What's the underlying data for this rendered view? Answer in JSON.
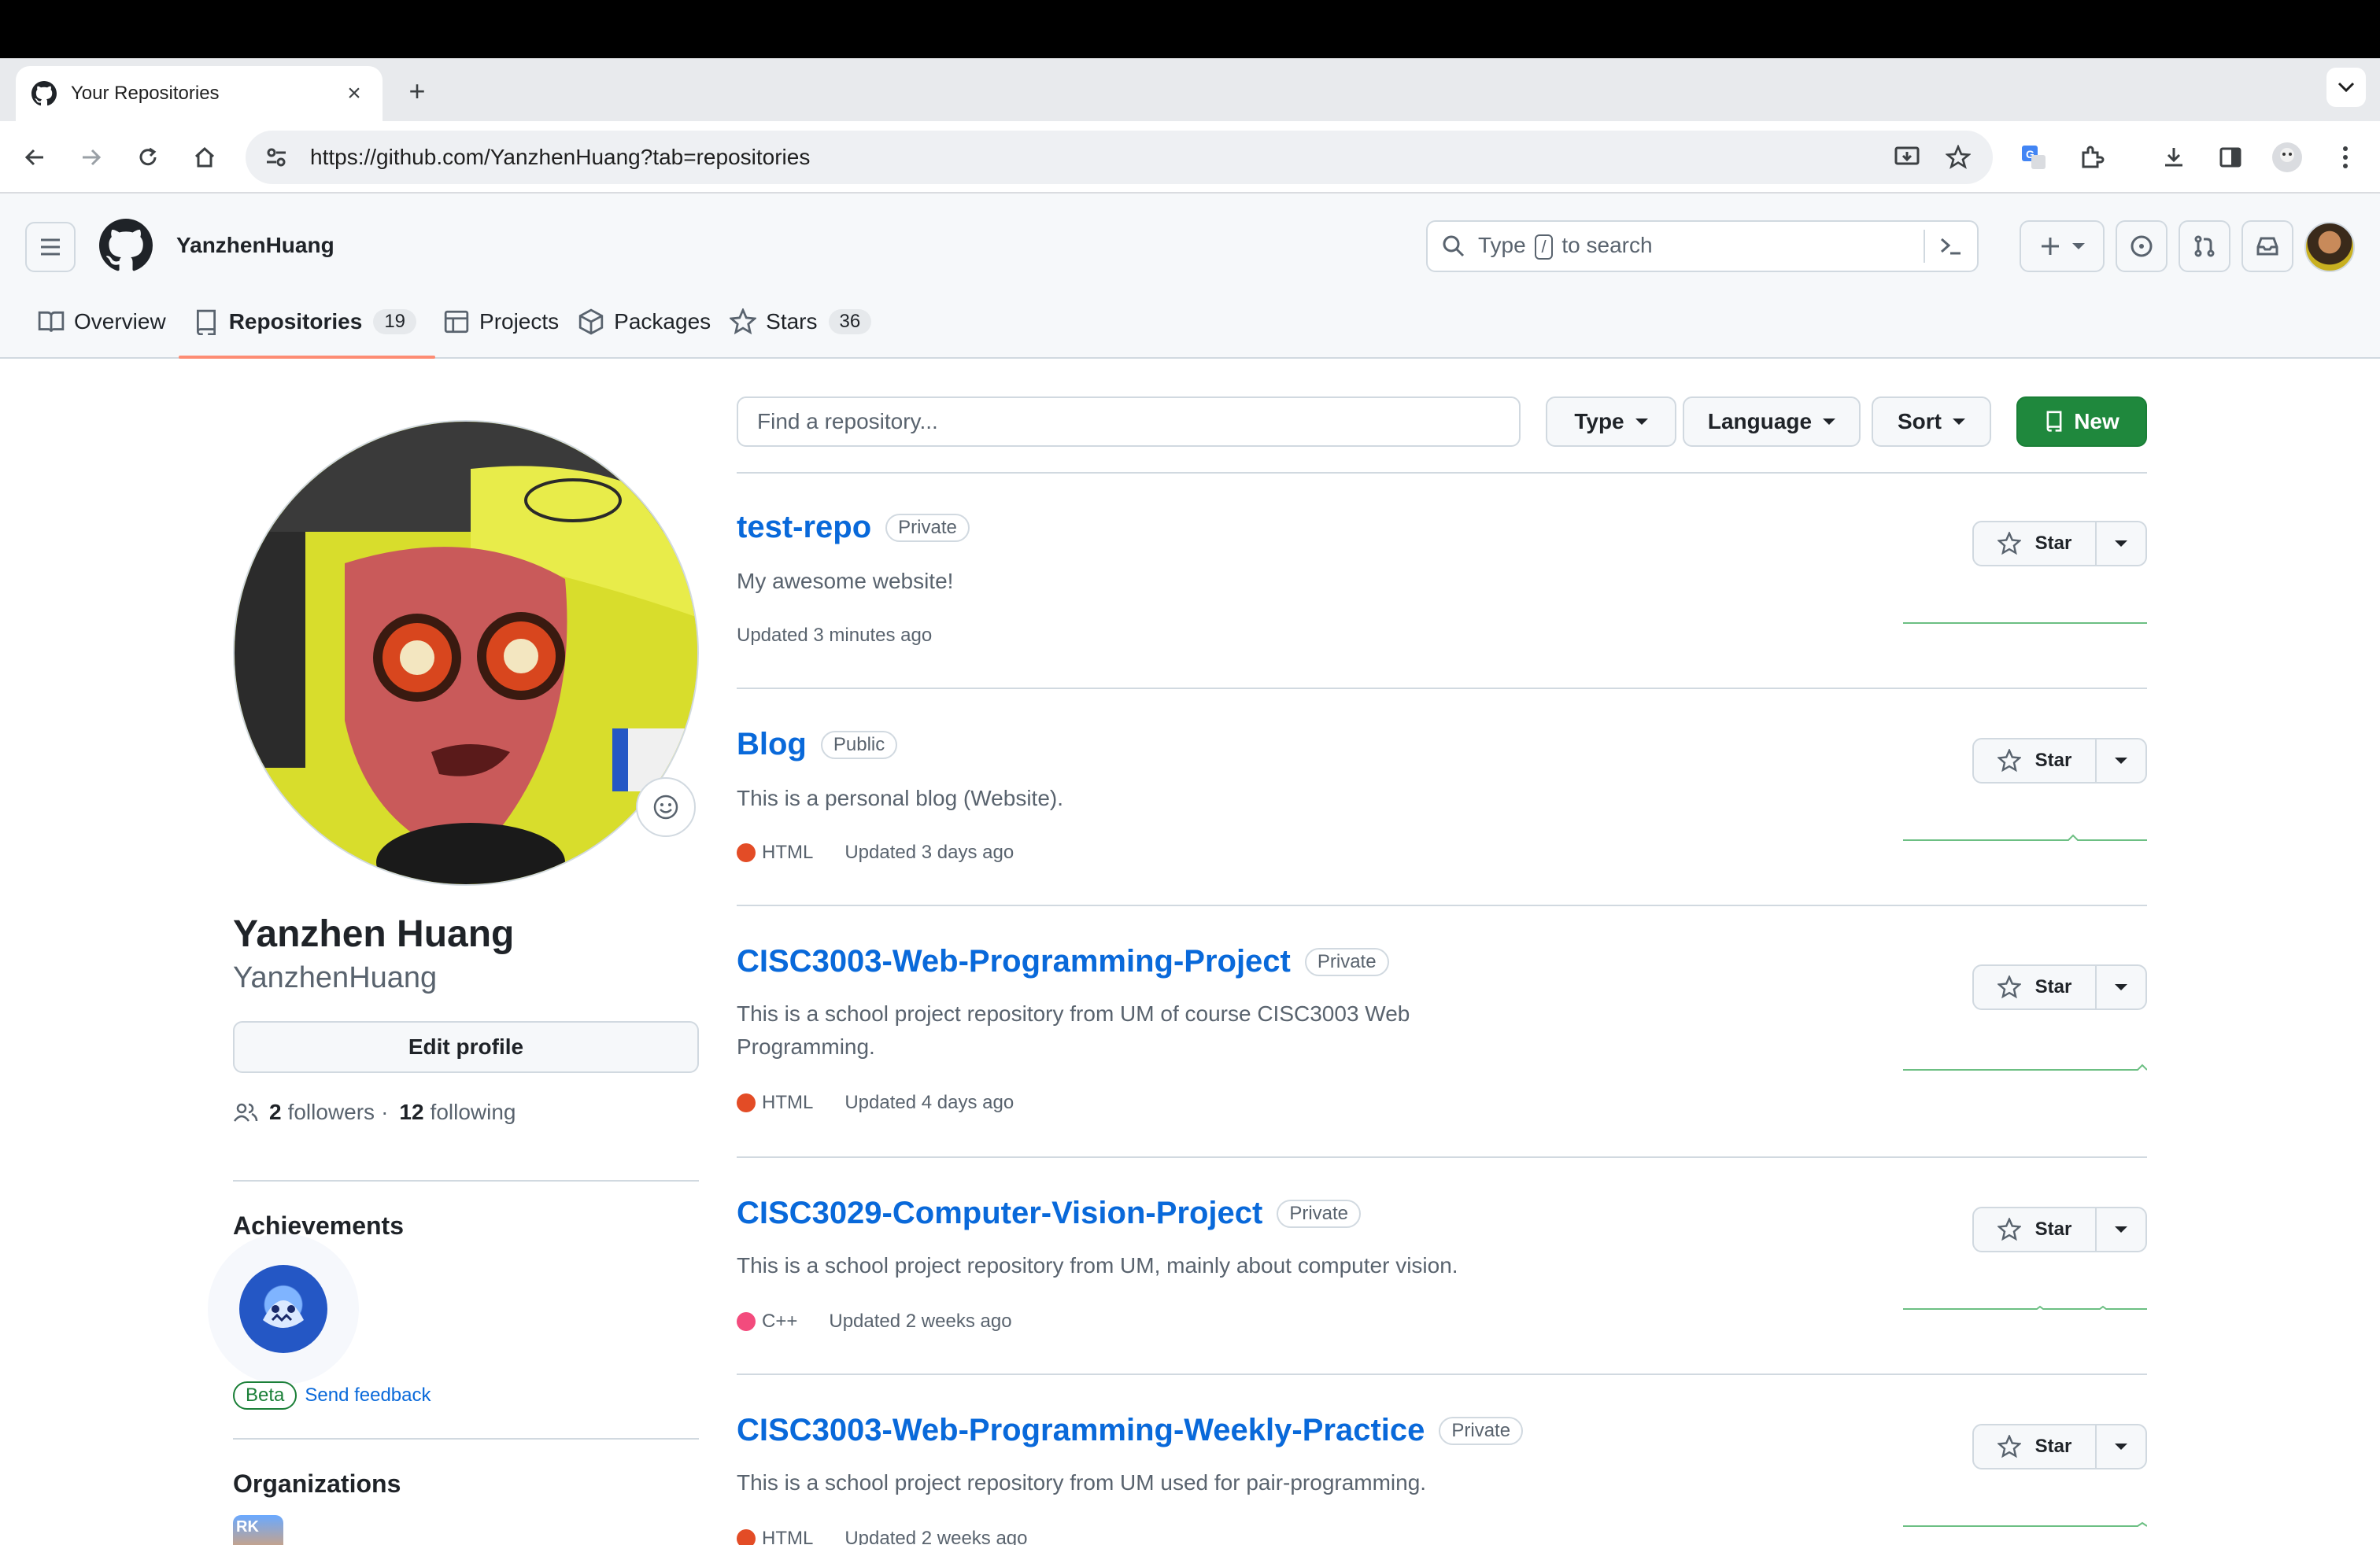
{
  "browser": {
    "tab_title": "Your Repositories",
    "url": "https://github.com/YanzhenHuang?tab=repositories"
  },
  "header": {
    "username": "YanzhenHuang",
    "search_placeholder_pre": "Type",
    "search_placeholder_key": "/",
    "search_placeholder_post": "to search"
  },
  "nav": {
    "overview": "Overview",
    "repositories": "Repositories",
    "repositories_count": "19",
    "projects": "Projects",
    "packages": "Packages",
    "stars": "Stars",
    "stars_count": "36"
  },
  "profile": {
    "full_name": "Yanzhen Huang",
    "login": "YanzhenHuang",
    "edit_label": "Edit profile",
    "followers_count": "2",
    "followers_label": "followers",
    "sep": "·",
    "following_count": "12",
    "following_label": "following",
    "achievements_title": "Achievements",
    "beta_label": "Beta",
    "feedback_label": "Send feedback",
    "organizations_title": "Organizations",
    "org_label": "RK"
  },
  "filters": {
    "find_placeholder": "Find a repository...",
    "type_label": "Type",
    "language_label": "Language",
    "sort_label": "Sort",
    "new_label": "New"
  },
  "repos": [
    {
      "name": "test-repo",
      "visibility": "Private",
      "description": "My awesome website!",
      "language": "",
      "lang_color": "",
      "updated": "Updated 3 minutes ago",
      "star_label": "Star"
    },
    {
      "name": "Blog",
      "visibility": "Public",
      "description": "This is a personal blog (Website).",
      "language": "HTML",
      "lang_color": "#e34c26",
      "updated": "Updated 3 days ago",
      "star_label": "Star"
    },
    {
      "name": "CISC3003-Web-Programming-Project",
      "visibility": "Private",
      "description": "This is a school project repository from UM of course CISC3003 Web Programming.",
      "language": "HTML",
      "lang_color": "#e34c26",
      "updated": "Updated 4 days ago",
      "star_label": "Star"
    },
    {
      "name": "CISC3029-Computer-Vision-Project",
      "visibility": "Private",
      "description": "This is a school project repository from UM, mainly about computer vision.",
      "language": "C++",
      "lang_color": "#f34b7d",
      "updated": "Updated 2 weeks ago",
      "star_label": "Star"
    },
    {
      "name": "CISC3003-Web-Programming-Weekly-Practice",
      "visibility": "Private",
      "description": "This is a school project repository from UM used for pair-programming.",
      "language": "HTML",
      "lang_color": "#e34c26",
      "updated": "Updated 2 weeks ago",
      "star_label": "Star"
    }
  ],
  "colors": {
    "link": "#0969da",
    "primary_button": "#1f883d",
    "active_tab_underline": "#fd8c73",
    "sparkline": "#2da44e"
  }
}
